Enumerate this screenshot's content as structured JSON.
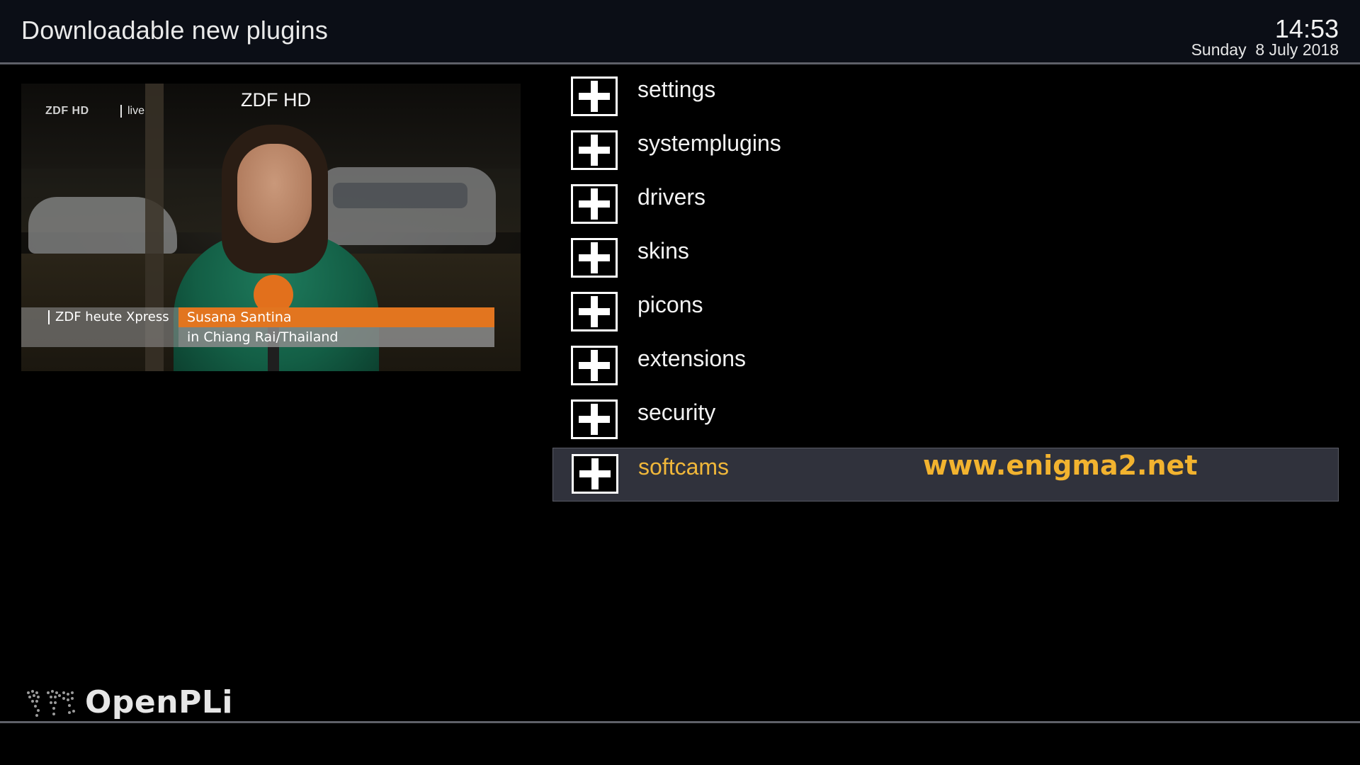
{
  "header": {
    "title": "Downloadable new plugins",
    "clock": "14:53",
    "date": "Sunday  8 July 2018"
  },
  "preview": {
    "channel_name": "ZDF HD",
    "overlay": {
      "logo": "ZDF HD",
      "live": "live",
      "show": "ZDF heute Xpress",
      "reporter_name": "Susana Santina",
      "reporter_location": "in Chiang Rai/Thailand"
    }
  },
  "plugins": {
    "items": [
      {
        "label": "settings",
        "icon": "plus-icon",
        "selected": false
      },
      {
        "label": "systemplugins",
        "icon": "plus-icon",
        "selected": false
      },
      {
        "label": "drivers",
        "icon": "plus-icon",
        "selected": false
      },
      {
        "label": "skins",
        "icon": "plus-icon",
        "selected": false
      },
      {
        "label": "picons",
        "icon": "plus-icon",
        "selected": false
      },
      {
        "label": "extensions",
        "icon": "plus-icon",
        "selected": false
      },
      {
        "label": "security",
        "icon": "plus-icon",
        "selected": false
      },
      {
        "label": "softcams",
        "icon": "plus-icon",
        "selected": true
      }
    ]
  },
  "watermark": "www.enigma2.net",
  "footer": {
    "brand": "OpenPLi"
  },
  "colors": {
    "background": "#000000",
    "header_background": "#0b0e16",
    "selection_background": "#30323c",
    "selected_text": "#f0b73a",
    "watermark": "#f2b32f",
    "lower_third_accent": "#e2751f"
  }
}
